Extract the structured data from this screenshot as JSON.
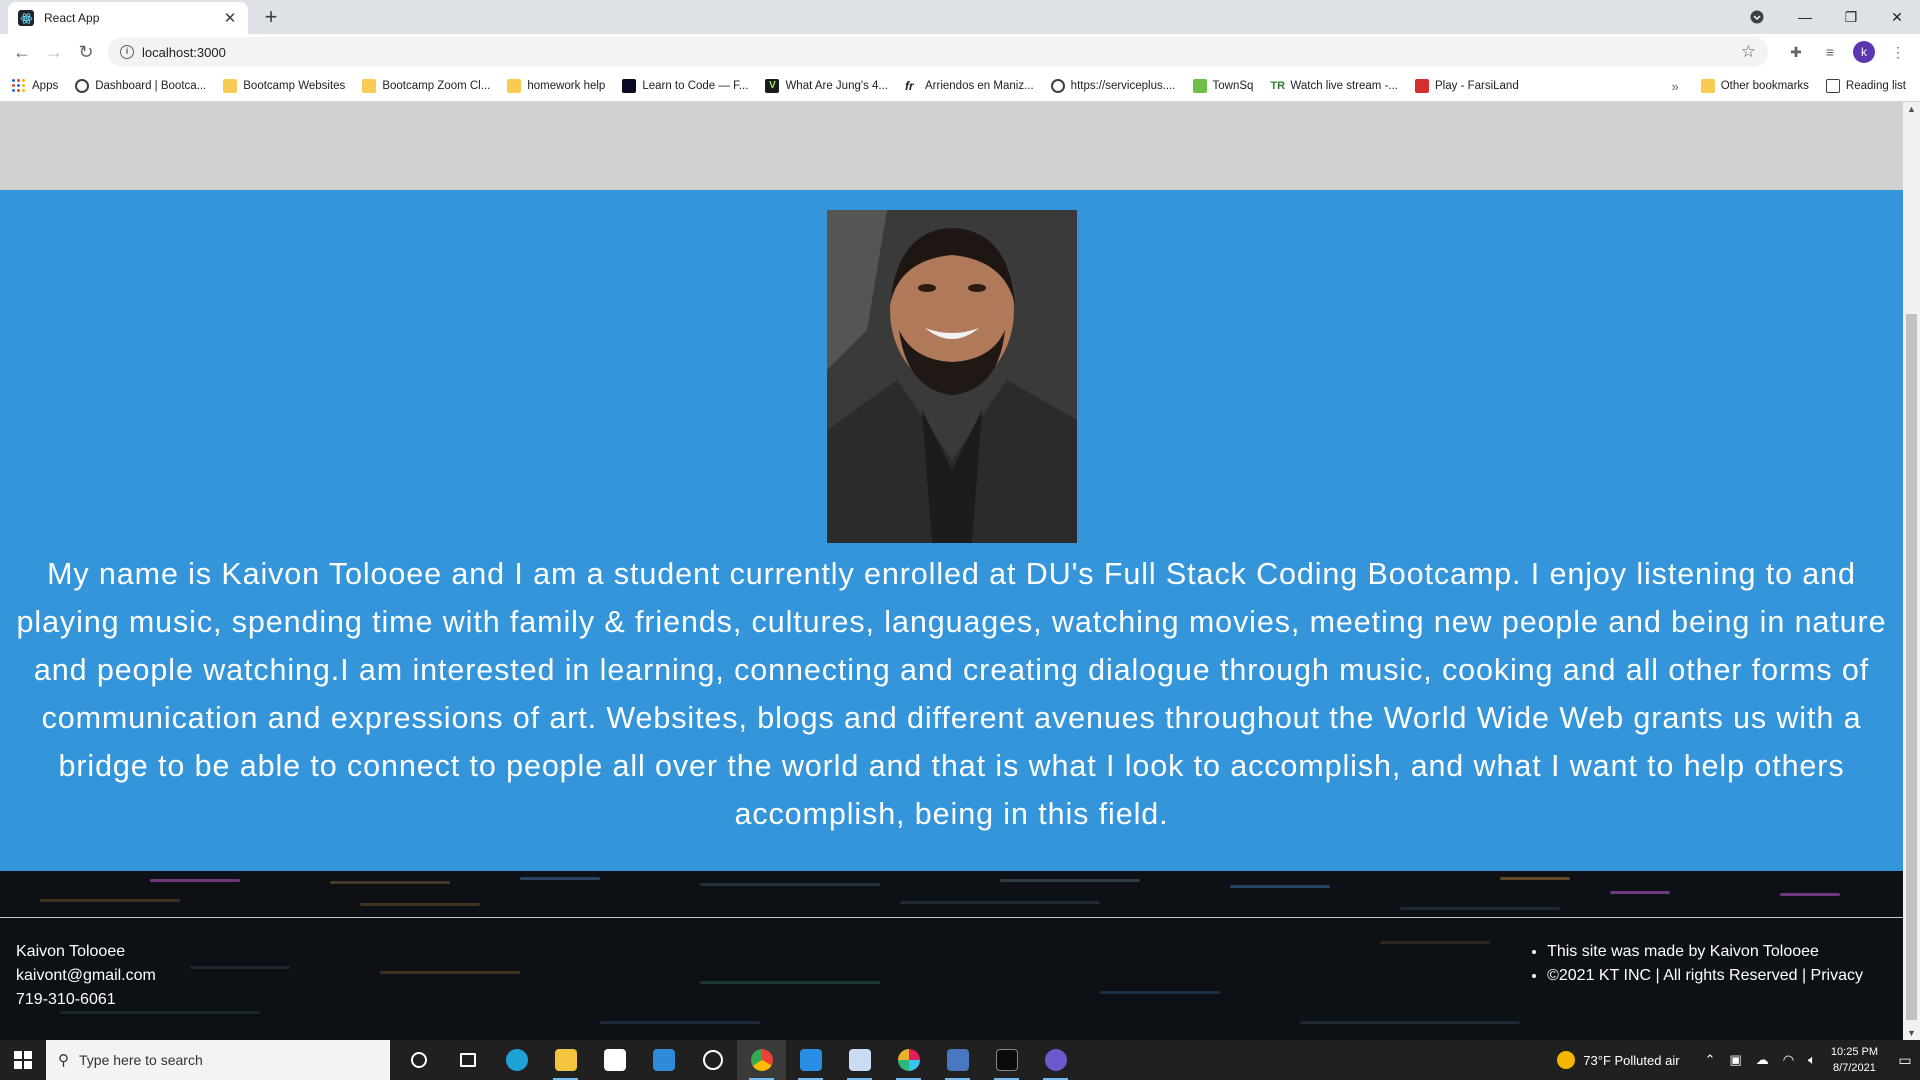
{
  "browser": {
    "tab_title": "React App",
    "tab_close": "✕",
    "new_tab": "+",
    "url": "localhost:3000",
    "window_controls": {
      "minimize": "—",
      "maximize": "❐",
      "close": "✕"
    },
    "profile_initial": "k",
    "bookmarks": [
      {
        "label": "Apps",
        "icon": "apps-grid-icon"
      },
      {
        "label": "Dashboard | Bootca...",
        "icon": "globe-icon"
      },
      {
        "label": "Bootcamp Websites",
        "icon": "folder-icon"
      },
      {
        "label": "Bootcamp Zoom Cl...",
        "icon": "folder-icon"
      },
      {
        "label": "homework help",
        "icon": "folder-icon"
      },
      {
        "label": "Learn to Code — F...",
        "icon": "freecodecamp-icon"
      },
      {
        "label": "What Are Jung's 4...",
        "icon": "v-icon"
      },
      {
        "label": "Arriendos en Maniz...",
        "icon": "fr-icon"
      },
      {
        "label": "https://serviceplus....",
        "icon": "globe-icon"
      },
      {
        "label": "TownSq",
        "icon": "townsq-icon"
      },
      {
        "label": "Watch live stream -...",
        "icon": "tr-icon"
      },
      {
        "label": "Play - FarsiLand",
        "icon": "farsiland-icon"
      }
    ],
    "bookmarks_overflow": "»",
    "other_bookmarks": "Other bookmarks",
    "reading_list": "Reading list"
  },
  "page": {
    "bio": "My name is Kaivon Tolooee and I am a student currently enrolled at DU's Full Stack Coding Bootcamp. I enjoy listening to and playing music, spending time with family & friends, cultures, languages, watching movies, meeting new people and being in nature and people watching.I am interested in learning, connecting and creating dialogue through music, cooking and all other forms of communication and expressions of art. Websites, blogs and different avenues throughout the World Wide Web grants us with a bridge to be able to connect to people all over the world and that is what I look to accomplish, and what I want to help others accomplish, being in this field.",
    "photo_label": "profile-photo",
    "footer": {
      "name": "Kaivon Tolooee",
      "email": "kaivont@gmail.com",
      "phone": "719-310-6061",
      "made_by": "This site was made by Kaivon Tolooee",
      "copyright": "©2021 KT INC | All rights Reserved | Privacy"
    }
  },
  "taskbar": {
    "search_placeholder": "Type here to search",
    "weather": "73°F  Polluted air",
    "time": "10:25 PM",
    "date": "8/7/2021",
    "apps": [
      {
        "icon": "cortana-icon",
        "color": "#ffffff"
      },
      {
        "icon": "task-view-icon",
        "color": "#ffffff"
      },
      {
        "icon": "edge-icon",
        "color": "#1fa0d6"
      },
      {
        "icon": "file-explorer-icon",
        "color": "#f5c342"
      },
      {
        "icon": "store-icon",
        "color": "#ffffff"
      },
      {
        "icon": "mail-icon",
        "color": "#2f8ad8"
      },
      {
        "icon": "dell-icon",
        "color": "#ffffff"
      },
      {
        "icon": "chrome-icon",
        "color": "#e94235"
      },
      {
        "icon": "vscode-icon",
        "color": "#2a8fe4"
      },
      {
        "icon": "notepad-icon",
        "color": "#c9dcf2"
      },
      {
        "icon": "slack-icon",
        "color": "#e01e5a"
      },
      {
        "icon": "git-icon",
        "color": "#4a78c0"
      },
      {
        "icon": "terminal-icon",
        "color": "#3a3a3a"
      },
      {
        "icon": "media-icon",
        "color": "#6a5acd"
      }
    ]
  }
}
